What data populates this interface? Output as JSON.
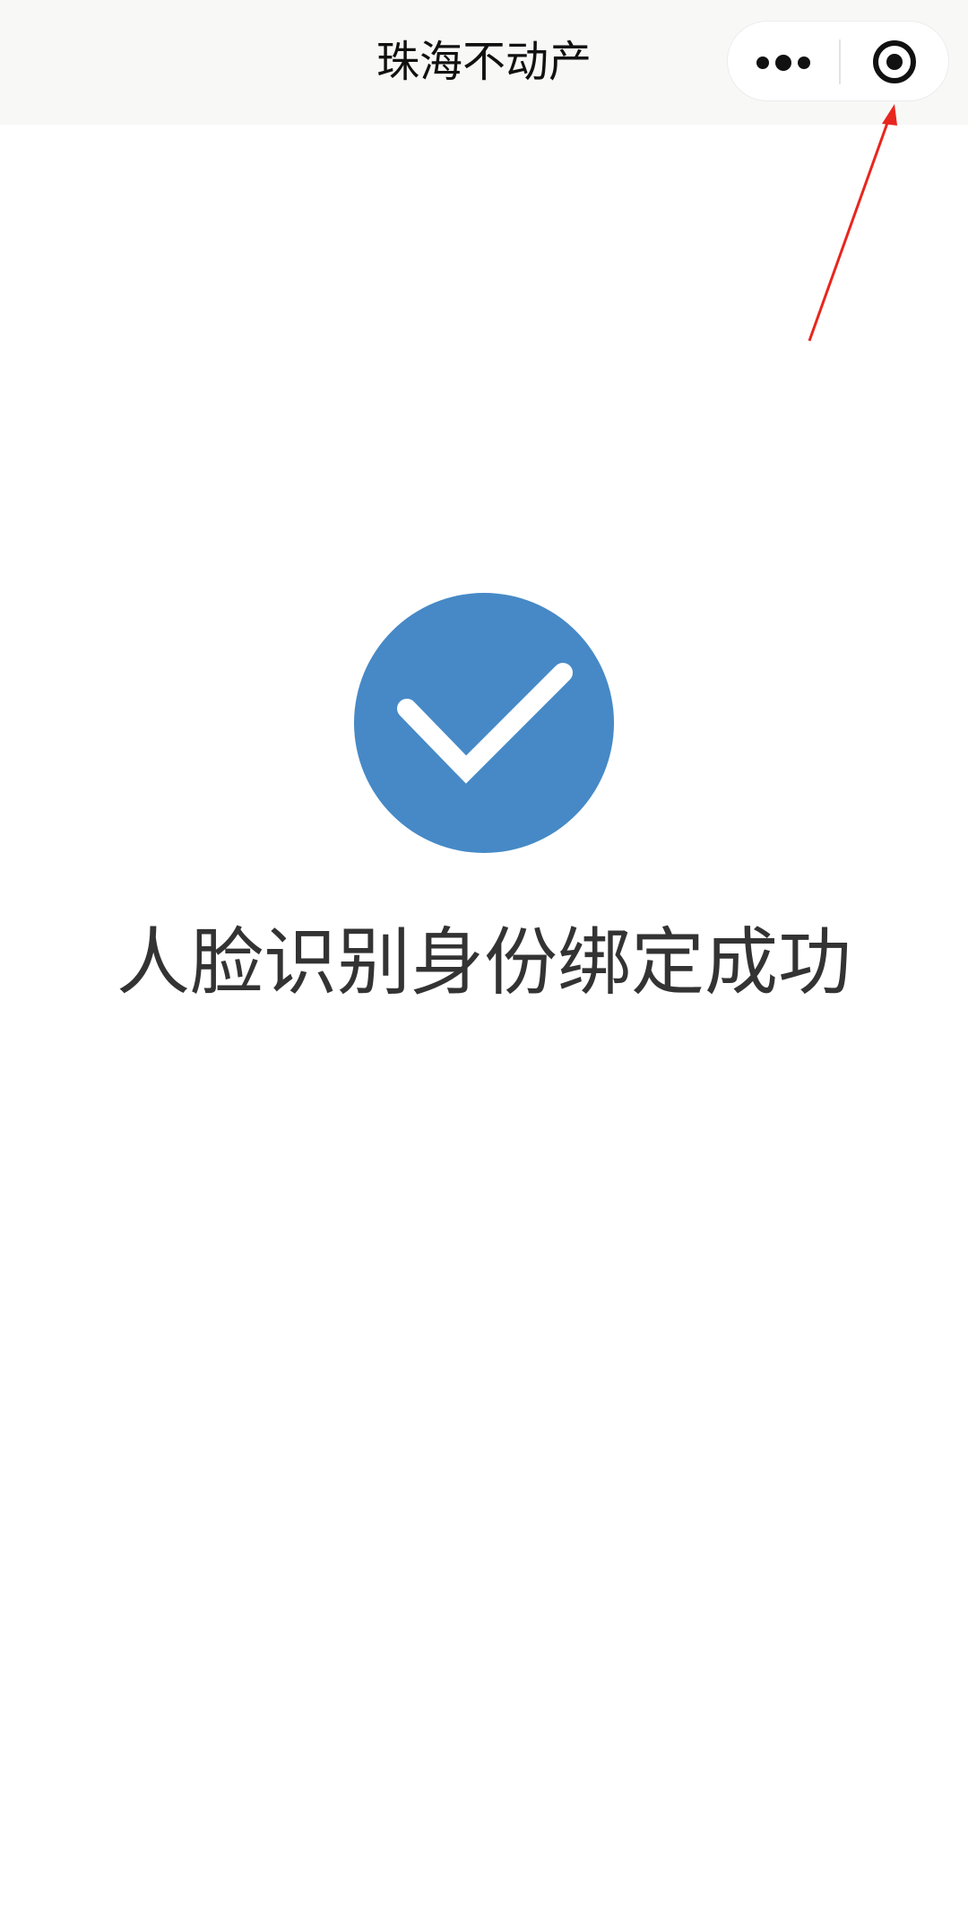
{
  "header": {
    "title": "珠海不动产",
    "more_icon": "more-dots-icon",
    "close_icon": "target-circle-icon"
  },
  "result": {
    "icon": "checkmark-circle-icon",
    "icon_color": "#4689c6",
    "message": "人脸识别身份绑定成功"
  },
  "annotation": {
    "arrow_color": "#e8261e"
  }
}
